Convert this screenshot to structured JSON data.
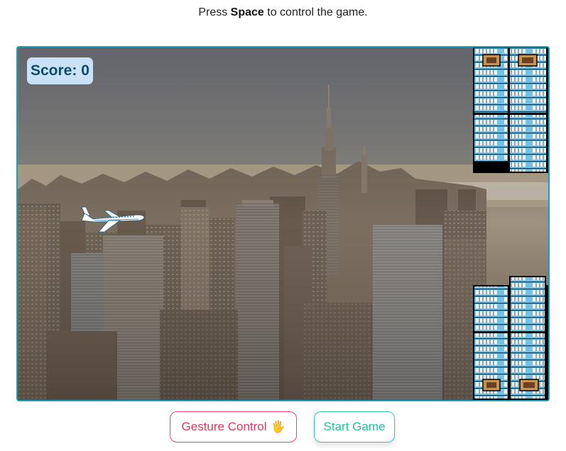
{
  "header": {
    "prefix": "Press ",
    "key": "Space",
    "suffix": " to control the game."
  },
  "game": {
    "score_label": "Score: 0",
    "score_value": 0,
    "frame_color": "#1f9fb3"
  },
  "controls": {
    "gesture_label": "Gesture Control",
    "gesture_icon": "waving-hand-icon",
    "gesture_emoji": "🖐",
    "start_label": "Start Game",
    "gesture_color": "#e3385f",
    "start_color": "#22bfa8"
  }
}
